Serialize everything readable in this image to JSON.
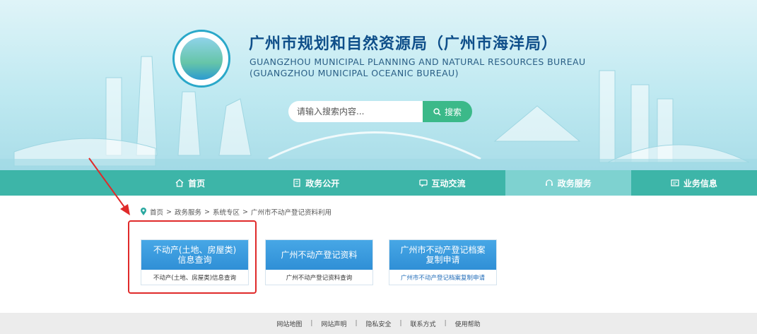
{
  "header": {
    "title_cn": "广州市规划和自然资源局（广州市海洋局）",
    "title_en_line1": "GUANGZHOU MUNICIPAL PLANNING AND NATURAL RESOURCES BUREAU",
    "title_en_line2": "(GUANGZHOU MUNICIPAL OCEANIC BUREAU)",
    "logo_icon": "bureau-emblem"
  },
  "search": {
    "placeholder": "请输入搜索内容...",
    "button_label": "搜索",
    "icon": "search-icon"
  },
  "nav": {
    "items": [
      {
        "label": "首页",
        "icon": "home-icon",
        "active": false
      },
      {
        "label": "政务公开",
        "icon": "document-icon",
        "active": false
      },
      {
        "label": "互动交流",
        "icon": "chat-icon",
        "active": false
      },
      {
        "label": "政务服务",
        "icon": "headset-icon",
        "active": true
      },
      {
        "label": "业务信息",
        "icon": "info-icon",
        "active": false
      }
    ]
  },
  "breadcrumb": {
    "items": [
      "首页",
      "政务服务",
      "系统专区",
      "广州市不动产登记资料利用"
    ],
    "separator": ">"
  },
  "cards": [
    {
      "title": "不动产(土地、房屋类)\n信息查询",
      "subtitle": "不动产(土地、房屋类)信息查询",
      "highlighted": true
    },
    {
      "title": "广州不动产登记资料",
      "subtitle": "广州不动产登记资料查询",
      "highlighted": false
    },
    {
      "title": "广州市不动产登记档案\n复制申请",
      "subtitle": "广州市不动产登记档案复制申请",
      "highlighted": false
    }
  ],
  "footer": {
    "links": [
      "网站地图",
      "网站声明",
      "隐私安全",
      "联系方式",
      "使用帮助"
    ],
    "separator": "|"
  },
  "colors": {
    "nav_bg": "#3db5a8",
    "nav_active": "#7ed2d0",
    "card_blue": "#2f8fd6",
    "search_btn": "#3bb989",
    "annotation_red": "#e02a2a",
    "title_blue": "#0f4f8a"
  }
}
